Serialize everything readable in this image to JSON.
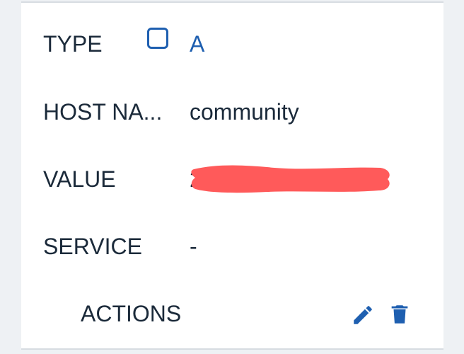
{
  "record": {
    "type_label": "TYPE",
    "type_value": "A",
    "host_label": "HOST NA...",
    "host_value": "community",
    "value_label": "VALUE",
    "value_visible_char": "2",
    "service_label": "SERVICE",
    "service_value": "-",
    "actions_label": "ACTIONS"
  },
  "colors": {
    "accent": "#1e5fb0",
    "text": "#1b2a3a",
    "redaction": "#ff5a5a",
    "background": "#eef1f4"
  },
  "icons": {
    "edit": "pencil-icon",
    "delete": "trash-icon",
    "checkbox": "checkbox-icon"
  }
}
